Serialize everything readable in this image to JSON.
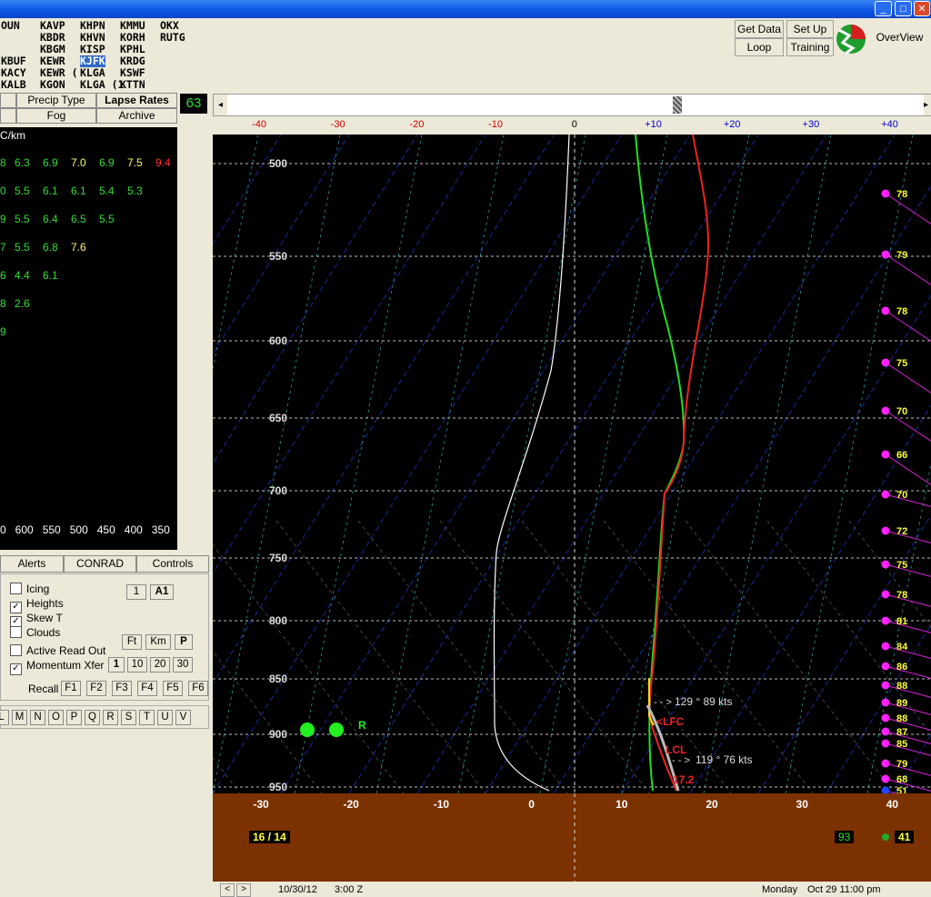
{
  "window": {
    "min": "_",
    "max": "□",
    "close": "✕"
  },
  "stations": [
    [
      "OUN",
      "KAVP",
      "KHPN",
      "KMMU",
      "OKX"
    ],
    [
      "",
      "KBDR",
      "KHVN",
      "KORH",
      "RUTG"
    ],
    [
      "",
      "KBGM",
      "KISP",
      "KPHL",
      ""
    ],
    [
      "KBUF",
      "KEWR",
      "KJFK",
      "KRDG",
      ""
    ],
    [
      "KACY",
      "KEWR (",
      "KLGA",
      "KSWF",
      ""
    ],
    [
      "KALB",
      "KGON",
      "KLGA (1",
      "KTTN",
      ""
    ]
  ],
  "selected_station": "KJFK",
  "top_buttons": {
    "get_data": "Get Data",
    "set_up": "Set Up",
    "loop": "Loop",
    "training": "Training",
    "overview": "OverView"
  },
  "tabs": {
    "precip_type": "Precip Type",
    "lapse_rates": "Lapse Rates",
    "fog": "Fog",
    "archive": "Archive"
  },
  "frame_counter": "63",
  "lapse_panel": {
    "unit_label": "C/km",
    "rows": [
      {
        "prefix": "8",
        "values": [
          "6.3",
          "6.9",
          "7.0",
          "6.9",
          "7.5",
          "9.4"
        ]
      },
      {
        "prefix": "0",
        "values": [
          "5.5",
          "6.1",
          "6.1",
          "5.4",
          "5.3"
        ]
      },
      {
        "prefix": "9",
        "values": [
          "5.5",
          "6.4",
          "6.5",
          "5.5"
        ]
      },
      {
        "prefix": "7",
        "values": [
          "5.5",
          "6.8",
          "7.6"
        ]
      },
      {
        "prefix": "6",
        "values": [
          "4.4",
          "6.1"
        ]
      },
      {
        "prefix": "8",
        "values": [
          "2.6"
        ]
      },
      {
        "prefix": "9",
        "values": []
      }
    ],
    "pressure_axis": "0   600   550   500   450   400   350"
  },
  "bottom_tabs": {
    "alerts": "Alerts",
    "conrad": "CONRAD",
    "controls": "Controls"
  },
  "controls": {
    "checkboxes": [
      {
        "label": "Icing",
        "checked": false
      },
      {
        "label": "Heights",
        "checked": true
      },
      {
        "label": "Skew T",
        "checked": true
      },
      {
        "label": "Clouds",
        "checked": false
      },
      {
        "label": "Active Read Out",
        "checked": false
      },
      {
        "label": "Momentum Xfer",
        "checked": true
      }
    ],
    "btn_1": "1",
    "btn_a1": "A1",
    "btn_ft": "Ft",
    "btn_km": "Km",
    "btn_p": "P",
    "btn_row": [
      "1",
      "10",
      "20",
      "30"
    ],
    "recall": "Recall",
    "f_keys": [
      "F1",
      "F2",
      "F3",
      "F4",
      "F5",
      "F6"
    ],
    "letters": [
      "L",
      "M",
      "N",
      "O",
      "P",
      "Q",
      "R",
      "S",
      "T",
      "U",
      "V"
    ]
  },
  "temp_scale_top": [
    "-40",
    "-30",
    "-20",
    "-10",
    "0",
    "+10",
    "+20",
    "+30",
    "+40"
  ],
  "temp_scale_bottom": [
    "-30",
    "-20",
    "-10",
    "0",
    "10",
    "20",
    "30",
    "40"
  ],
  "pressure_labels": [
    "500",
    "550",
    "600",
    "650",
    "700",
    "750",
    "800",
    "850",
    "900",
    "950"
  ],
  "wind_labels": [
    "78",
    "79",
    "78",
    "75",
    "70",
    "66",
    "70",
    "72",
    "75",
    "78",
    "81",
    "84",
    "86",
    "88",
    "89",
    "88",
    "87",
    "85",
    "79",
    "68",
    "51"
  ],
  "annotations": {
    "wind1": "129 ° 89 kts",
    "wind2": "119 ° 76 kts",
    "lfc": "<LFC",
    "lcl": "LCL",
    "temp": "17.2",
    "r_label": "R"
  },
  "surface_box": "16 / 14",
  "box_93": "93",
  "box_41": "41",
  "status": {
    "nav_left": "<",
    "nav_right": ">",
    "date": "10/30/12",
    "time": "3:00 Z",
    "day": "Monday",
    "datetime": "Oct 29 11:00 pm"
  }
}
